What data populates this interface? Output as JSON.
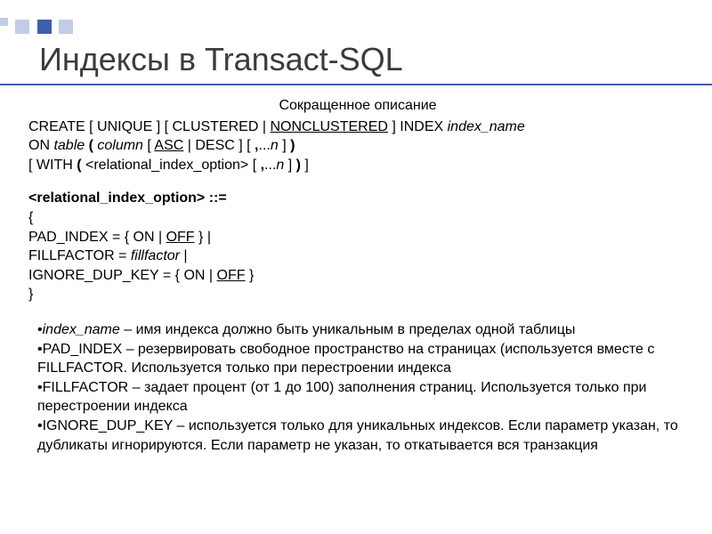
{
  "title": "Индексы в Transact-SQL",
  "subtitle": "Сокращенное описание",
  "syntax": {
    "create": "CREATE [ UNIQUE ] [ CLUSTERED | ",
    "nonclustered": "NONCLUSTERED",
    "create_tail": " ] INDEX ",
    "index_name": "index_name",
    "on": "ON ",
    "table": "table",
    "paren1": " ( ",
    "column": "column",
    "bracket1": " [ ",
    "asc": "ASC",
    "pipe_desc": " | DESC ] [ ",
    "comma_dots": ",",
    "dots1": "...",
    "n1": "n",
    "close1": " ] ",
    "paren_close1": ")",
    "with_open": "[ WITH ",
    "with_paren": "(",
    "rel_opt": " <relational_index_option> [ ",
    "comma2": ",",
    "dots2": "...",
    "n2": "n",
    "close2": " ] ",
    "paren_close2": ")",
    "with_close": " ]"
  },
  "option_block": {
    "header": "<relational_index_option> ::=",
    "brace_open": "{",
    "pad": "PAD_INDEX = { ON | ",
    "off1": "OFF",
    "pad_tail": " }   |",
    "fill": "FILLFACTOR = ",
    "fillfactor": "fillfactor",
    "fill_tail": "   |",
    "ign": "IGNORE_DUP_KEY = { ON | ",
    "off2": "OFF",
    "ign_tail": " }",
    "brace_close": "}"
  },
  "bullets": {
    "b1_term": "index_name",
    "b1_text": " – имя индекса должно быть уникальным в пределах одной таблицы",
    "b2_term": "PAD_INDEX – ",
    "b2_text": "резервировать свободное пространство на страницах (используется вместе с FILLFACTOR. Используется только при перестроении индекса",
    "b3_term": "FILLFACTOR – ",
    "b3_text": "задает процент (от 1 до 100) заполнения  страниц. Используется только при перестроении индекса",
    "b4_term": "IGNORE_DUP_KEY – ",
    "b4_text": "используется только для уникальных индексов. Если параметр указан, то дубликаты игнорируются. Если параметр не указан, то откатывается вся транзакция"
  }
}
